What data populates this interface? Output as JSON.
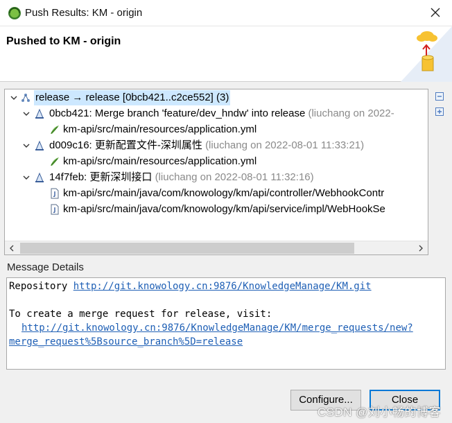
{
  "window": {
    "title": "Push Results: KM - origin",
    "app_icon": "eclipse-icon",
    "close_icon": "close-icon"
  },
  "header": {
    "title": "Pushed to KM - origin",
    "graphic_icon": "push-to-cloud-icon"
  },
  "tree": {
    "root": {
      "text": "release → release [0bcb421..c2ce552] (3)",
      "icon": "remote-branch-icon",
      "selected": true
    },
    "commits": [
      {
        "id_msg": "0bcb421: Merge branch 'feature/dev_hndw' into release",
        "meta": "(liuchang on 2022-",
        "files": [
          {
            "path": "km-api/src/main/resources/application.yml",
            "icon": "yaml-file-icon"
          }
        ]
      },
      {
        "id_msg": "d009c16: 更新配置文件-深圳属性",
        "meta": "(liuchang on 2022-08-01 11:33:21)",
        "files": [
          {
            "path": "km-api/src/main/resources/application.yml",
            "icon": "yaml-file-icon"
          }
        ]
      },
      {
        "id_msg": "14f7feb: 更新深圳接口",
        "meta": "(liuchang on 2022-08-01 11:32:16)",
        "files": [
          {
            "path": "km-api/src/main/java/com/knowology/km/api/controller/WebhookContr",
            "icon": "java-file-icon"
          },
          {
            "path": "km-api/src/main/java/com/knowology/km/api/service/impl/WebHookSe",
            "icon": "java-file-icon"
          }
        ]
      }
    ],
    "side_buttons": [
      "collapse-all-icon",
      "expand-all-icon"
    ]
  },
  "message_details": {
    "label": "Message Details",
    "repo_prefix": "Repository ",
    "repo_url": "http://git.knowology.cn:9876/KnowledgeManage/KM.git",
    "merge_text": "To create a merge request for release, visit:",
    "merge_url_line1": "http://git.knowology.cn:9876/KnowledgeManage/KM/merge_requests/new?",
    "merge_url_line2": "merge_request%5Bsource_branch%5D=release"
  },
  "buttons": {
    "configure": "Configure...",
    "close": "Close"
  },
  "watermark": "CSDN @刘小畅的博客"
}
